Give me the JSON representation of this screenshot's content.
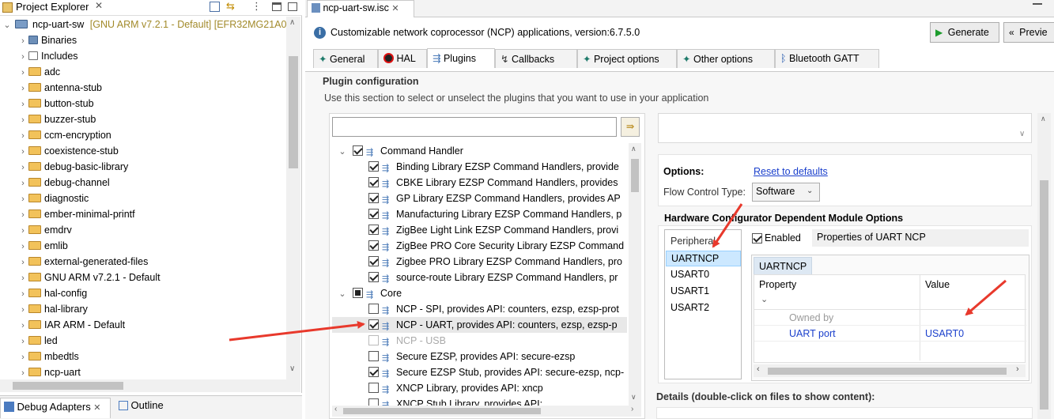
{
  "project_explorer": {
    "title": "Project Explorer",
    "root": "ncp-uart-sw",
    "root_suffix": "[GNU ARM v7.2.1 - Default] [EFR32MG21A0",
    "items": [
      {
        "label": "Binaries",
        "icon": "binaries-icon"
      },
      {
        "label": "Includes",
        "icon": "includes-icon"
      },
      {
        "label": "adc",
        "icon": "folder-icon"
      },
      {
        "label": "antenna-stub",
        "icon": "folder-icon"
      },
      {
        "label": "button-stub",
        "icon": "folder-icon"
      },
      {
        "label": "buzzer-stub",
        "icon": "folder-icon"
      },
      {
        "label": "ccm-encryption",
        "icon": "folder-icon"
      },
      {
        "label": "coexistence-stub",
        "icon": "folder-icon"
      },
      {
        "label": "debug-basic-library",
        "icon": "folder-icon"
      },
      {
        "label": "debug-channel",
        "icon": "folder-icon"
      },
      {
        "label": "diagnostic",
        "icon": "folder-icon"
      },
      {
        "label": "ember-minimal-printf",
        "icon": "folder-icon"
      },
      {
        "label": "emdrv",
        "icon": "folder-icon"
      },
      {
        "label": "emlib",
        "icon": "folder-icon"
      },
      {
        "label": "external-generated-files",
        "icon": "folder-icon"
      },
      {
        "label": "GNU ARM v7.2.1 - Default",
        "icon": "folder-icon"
      },
      {
        "label": "hal-config",
        "icon": "folder-icon"
      },
      {
        "label": "hal-library",
        "icon": "folder-icon"
      },
      {
        "label": "IAR ARM - Default",
        "icon": "folder-icon"
      },
      {
        "label": "led",
        "icon": "folder-icon"
      },
      {
        "label": "mbedtls",
        "icon": "folder-icon"
      },
      {
        "label": "ncp-uart",
        "icon": "folder-icon"
      }
    ]
  },
  "bottom_tabs": {
    "debug": "Debug Adapters",
    "outline": "Outline"
  },
  "editor": {
    "tab_title": "ncp-uart-sw.isc",
    "info": "Customizable network coprocessor (NCP) applications, version:6.7.5.0",
    "generate": "Generate",
    "preview": "Previe",
    "tabs": [
      "General",
      "HAL",
      "Plugins",
      "Callbacks",
      "Project options",
      "Other options",
      "Bluetooth GATT"
    ],
    "section_title": "Plugin configuration",
    "section_desc": "Use this section to select or unselect the plugins that you want to use in your application",
    "search_value": ""
  },
  "plugins": [
    {
      "type": "group",
      "label": "Command Handler",
      "check": "on"
    },
    {
      "type": "item",
      "label": "Binding Library EZSP Command Handlers, provide",
      "check": "on"
    },
    {
      "type": "item",
      "label": "CBKE Library EZSP Command Handlers, provides",
      "check": "on"
    },
    {
      "type": "item",
      "label": "GP Library EZSP Command Handlers, provides AP",
      "check": "on"
    },
    {
      "type": "item",
      "label": "Manufacturing Library EZSP Command Handlers, p",
      "check": "on"
    },
    {
      "type": "item",
      "label": "ZigBee Light Link EZSP Command Handlers, provi",
      "check": "on"
    },
    {
      "type": "item",
      "label": "ZigBee PRO Core Security Library EZSP Command",
      "check": "on"
    },
    {
      "type": "item",
      "label": "Zigbee PRO Library EZSP Command Handlers, pro",
      "check": "on"
    },
    {
      "type": "item",
      "label": "source-route Library EZSP Command Handlers, pr",
      "check": "on"
    },
    {
      "type": "group",
      "label": "Core",
      "check": "part"
    },
    {
      "type": "item",
      "label": "NCP - SPI, provides API: counters, ezsp, ezsp-prot",
      "check": "off"
    },
    {
      "type": "item",
      "label": "NCP - UART, provides API: counters, ezsp, ezsp-p",
      "check": "on",
      "selected": true
    },
    {
      "type": "item",
      "label": "NCP - USB",
      "check": "dis"
    },
    {
      "type": "item",
      "label": "Secure EZSP, provides API: secure-ezsp",
      "check": "off"
    },
    {
      "type": "item",
      "label": "Secure EZSP Stub, provides API: secure-ezsp, ncp-",
      "check": "on"
    },
    {
      "type": "item",
      "label": "XNCP Library, provides API: xncp",
      "check": "off"
    },
    {
      "type": "item",
      "label": "XNCP Stub Library, provides API:",
      "check": "off"
    }
  ],
  "options": {
    "title": "Options:",
    "reset": "Reset to defaults",
    "flow_label": "Flow Control Type:",
    "flow_value": "Software"
  },
  "hw": {
    "title": "Hardware Configurator Dependent Module Options",
    "list": [
      "Peripheral",
      "UARTNCP",
      "USART0",
      "USART1",
      "USART2"
    ],
    "enabled_label": "Enabled",
    "properties_title": "Properties of UART NCP",
    "inner_tab": "UARTNCP",
    "col_property": "Property",
    "col_value": "Value",
    "rows": [
      {
        "property": "Owned by",
        "value": ""
      },
      {
        "property": "UART port",
        "value": "USART0"
      }
    ]
  },
  "details": "Details (double-click on files to show content):",
  "colors": {
    "accent": "#3a6ea5",
    "arrow": "#e8392c",
    "selection": "#cce8ff",
    "link": "#1a3fcc"
  }
}
